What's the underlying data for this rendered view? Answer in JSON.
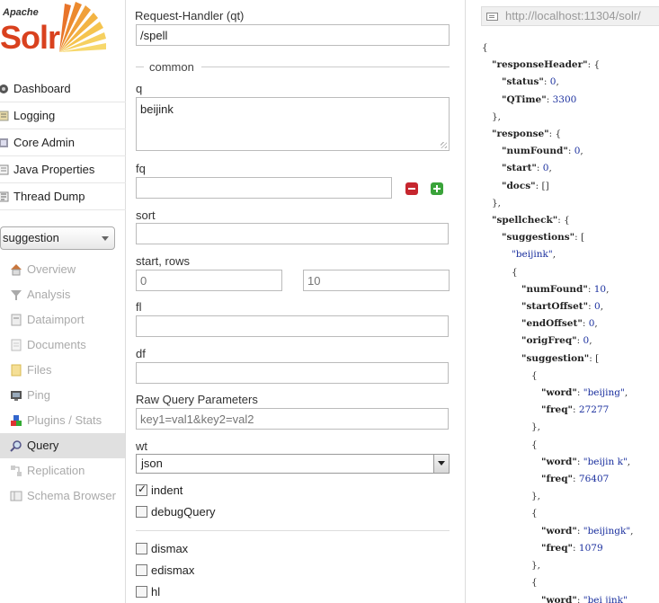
{
  "sidebar": {
    "logo": {
      "small": "Apache",
      "big": "Solr"
    },
    "nav": [
      {
        "label": "Dashboard",
        "icon": "dashboard-icon"
      },
      {
        "label": "Logging",
        "icon": "logging-icon"
      },
      {
        "label": "Core Admin",
        "icon": "core-admin-icon"
      },
      {
        "label": "Java Properties",
        "icon": "java-properties-icon"
      },
      {
        "label": "Thread Dump",
        "icon": "thread-dump-icon"
      }
    ],
    "core_selector": "suggestion",
    "core_nav": [
      {
        "label": "Overview",
        "icon": "home-icon"
      },
      {
        "label": "Analysis",
        "icon": "filter-icon"
      },
      {
        "label": "Dataimport",
        "icon": "dataimport-icon"
      },
      {
        "label": "Documents",
        "icon": "documents-icon"
      },
      {
        "label": "Files",
        "icon": "folder-icon"
      },
      {
        "label": "Ping",
        "icon": "ping-icon"
      },
      {
        "label": "Plugins / Stats",
        "icon": "plugins-icon"
      },
      {
        "label": "Query",
        "icon": "magnifier-icon",
        "active": true
      },
      {
        "label": "Replication",
        "icon": "replication-icon"
      },
      {
        "label": "Schema Browser",
        "icon": "schema-icon"
      }
    ]
  },
  "form": {
    "qt_label": "Request-Handler (qt)",
    "qt_value": "/spell",
    "section_common": "common",
    "q_label": "q",
    "q_value": "beijink",
    "fq_label": "fq",
    "fq_value": "",
    "sort_label": "sort",
    "sort_value": "",
    "start_rows_label": "start, rows",
    "start_placeholder": "0",
    "rows_placeholder": "10",
    "fl_label": "fl",
    "fl_value": "",
    "df_label": "df",
    "df_value": "",
    "raw_label": "Raw Query Parameters",
    "raw_placeholder": "key1=val1&key2=val2",
    "wt_label": "wt",
    "wt_value": "json",
    "indent_label": "indent",
    "indent_checked": true,
    "debug_label": "debugQuery",
    "debug_checked": false,
    "dismax_label": "dismax",
    "edismax_label": "edismax",
    "hl_label": "hl"
  },
  "result": {
    "url": "http://localhost:11304/solr/",
    "json_lines": [
      [
        0,
        [
          [
            "p",
            "{"
          ]
        ]
      ],
      [
        1,
        [
          [
            "k",
            "\"responseHeader\""
          ],
          [
            "p",
            ": {"
          ]
        ]
      ],
      [
        2,
        [
          [
            "k",
            "\"status\""
          ],
          [
            "p",
            ": "
          ],
          [
            "n",
            "0"
          ],
          [
            "p",
            ","
          ]
        ]
      ],
      [
        2,
        [
          [
            "k",
            "\"QTime\""
          ],
          [
            "p",
            ": "
          ],
          [
            "n",
            "3300"
          ]
        ]
      ],
      [
        1,
        [
          [
            "p",
            "},"
          ]
        ]
      ],
      [
        1,
        [
          [
            "k",
            "\"response\""
          ],
          [
            "p",
            ": {"
          ]
        ]
      ],
      [
        2,
        [
          [
            "k",
            "\"numFound\""
          ],
          [
            "p",
            ": "
          ],
          [
            "n",
            "0"
          ],
          [
            "p",
            ","
          ]
        ]
      ],
      [
        2,
        [
          [
            "k",
            "\"start\""
          ],
          [
            "p",
            ": "
          ],
          [
            "n",
            "0"
          ],
          [
            "p",
            ","
          ]
        ]
      ],
      [
        2,
        [
          [
            "k",
            "\"docs\""
          ],
          [
            "p",
            ": []"
          ]
        ]
      ],
      [
        1,
        [
          [
            "p",
            "},"
          ]
        ]
      ],
      [
        1,
        [
          [
            "k",
            "\"spellcheck\""
          ],
          [
            "p",
            ": {"
          ]
        ]
      ],
      [
        2,
        [
          [
            "k",
            "\"suggestions\""
          ],
          [
            "p",
            ": ["
          ]
        ]
      ],
      [
        3,
        [
          [
            "s",
            "\"beijink\""
          ],
          [
            "p",
            ","
          ]
        ]
      ],
      [
        3,
        [
          [
            "p",
            "{"
          ]
        ]
      ],
      [
        4,
        [
          [
            "k",
            "\"numFound\""
          ],
          [
            "p",
            ": "
          ],
          [
            "n",
            "10"
          ],
          [
            "p",
            ","
          ]
        ]
      ],
      [
        4,
        [
          [
            "k",
            "\"startOffset\""
          ],
          [
            "p",
            ": "
          ],
          [
            "n",
            "0"
          ],
          [
            "p",
            ","
          ]
        ]
      ],
      [
        4,
        [
          [
            "k",
            "\"endOffset\""
          ],
          [
            "p",
            ": "
          ],
          [
            "n",
            "0"
          ],
          [
            "p",
            ","
          ]
        ]
      ],
      [
        4,
        [
          [
            "k",
            "\"origFreq\""
          ],
          [
            "p",
            ": "
          ],
          [
            "n",
            "0"
          ],
          [
            "p",
            ","
          ]
        ]
      ],
      [
        4,
        [
          [
            "k",
            "\"suggestion\""
          ],
          [
            "p",
            ": ["
          ]
        ]
      ],
      [
        5,
        [
          [
            "p",
            "{"
          ]
        ]
      ],
      [
        6,
        [
          [
            "k",
            "\"word\""
          ],
          [
            "p",
            ": "
          ],
          [
            "s",
            "\"beijing\""
          ],
          [
            "p",
            ","
          ]
        ]
      ],
      [
        6,
        [
          [
            "k",
            "\"freq\""
          ],
          [
            "p",
            ": "
          ],
          [
            "n",
            "27277"
          ]
        ]
      ],
      [
        5,
        [
          [
            "p",
            "},"
          ]
        ]
      ],
      [
        5,
        [
          [
            "p",
            "{"
          ]
        ]
      ],
      [
        6,
        [
          [
            "k",
            "\"word\""
          ],
          [
            "p",
            ": "
          ],
          [
            "s",
            "\"beijin k\""
          ],
          [
            "p",
            ","
          ]
        ]
      ],
      [
        6,
        [
          [
            "k",
            "\"freq\""
          ],
          [
            "p",
            ": "
          ],
          [
            "n",
            "76407"
          ]
        ]
      ],
      [
        5,
        [
          [
            "p",
            "},"
          ]
        ]
      ],
      [
        5,
        [
          [
            "p",
            "{"
          ]
        ]
      ],
      [
        6,
        [
          [
            "k",
            "\"word\""
          ],
          [
            "p",
            ": "
          ],
          [
            "s",
            "\"beijingk\""
          ],
          [
            "p",
            ","
          ]
        ]
      ],
      [
        6,
        [
          [
            "k",
            "\"freq\""
          ],
          [
            "p",
            ": "
          ],
          [
            "n",
            "1079"
          ]
        ]
      ],
      [
        5,
        [
          [
            "p",
            "},"
          ]
        ]
      ],
      [
        5,
        [
          [
            "p",
            "{"
          ]
        ]
      ],
      [
        6,
        [
          [
            "k",
            "\"word\""
          ],
          [
            "p",
            ": "
          ],
          [
            "s",
            "\"bei jink\""
          ]
        ]
      ]
    ]
  },
  "colors": {
    "brand": "#d9411e",
    "json_value": "#1a2f9e",
    "active_nav_bg": "#e0e0e0"
  }
}
